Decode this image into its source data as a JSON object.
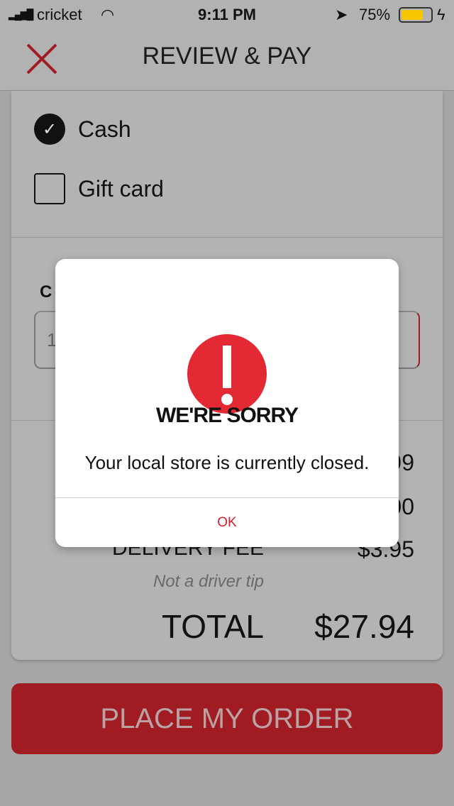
{
  "status_bar": {
    "carrier": "cricket",
    "time": "9:11 PM",
    "battery": "75%",
    "battery_level": 0.75,
    "battery_color": "#f7c600"
  },
  "header": {
    "title": "REVIEW & PAY",
    "close_icon": "close-icon",
    "close_color": "#a01c22"
  },
  "payment": {
    "options": [
      {
        "label": "Cash",
        "checked": true
      },
      {
        "label": "Gift card",
        "checked": false
      }
    ]
  },
  "partial": {
    "label": "C",
    "input_value": "1",
    "subtotal_fragment": "99",
    "tax_fragment": "00"
  },
  "summary": {
    "delivery_label": "DELIVERY FEE",
    "delivery_value": "$3.95",
    "delivery_note": "Not a driver tip",
    "total_label": "TOTAL",
    "total_value": "$27.94"
  },
  "place_order": "PLACE MY ORDER",
  "modal": {
    "icon": "alert-icon",
    "title": "WE'RE SORRY",
    "message": "Your local store is currently closed.",
    "ok": "OK",
    "accent": "#e32934"
  }
}
